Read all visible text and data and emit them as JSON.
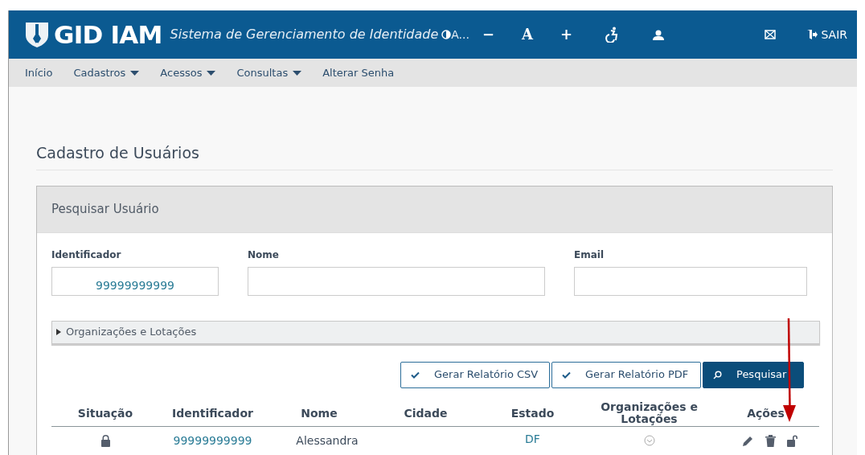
{
  "header": {
    "logo": "GID IAM",
    "subtitle": "Sistema de Gerenciamento de Identidade",
    "contrast_suffix": "A...",
    "font_tools": [
      "−",
      "A",
      "+"
    ],
    "logout": "SAIR"
  },
  "nav": [
    {
      "label": "Início",
      "dropdown": false
    },
    {
      "label": "Cadastros",
      "dropdown": true
    },
    {
      "label": "Acessos",
      "dropdown": true
    },
    {
      "label": "Consultas",
      "dropdown": true
    },
    {
      "label": "Alterar Senha",
      "dropdown": false
    }
  ],
  "page_title": "Cadastro de Usuários",
  "panel": {
    "title": "Pesquisar Usuário",
    "fields": [
      {
        "label": "Identificador",
        "value": "99999999999"
      },
      {
        "label": "Nome"
      },
      {
        "label": "Email"
      }
    ],
    "collapsible": {
      "label": "Organizações e Lotações",
      "expanded": false
    },
    "buttons": [
      {
        "label": "Gerar Relatório CSV",
        "kind": "outline"
      },
      {
        "label": "Gerar Relatório PDF",
        "kind": "outline"
      },
      {
        "label": "Pesquisar",
        "kind": "primary"
      }
    ],
    "table": {
      "columns": [
        "Situação",
        "Identificador",
        "Nome",
        "Cidade",
        "Estado",
        "Organizações e Lotações",
        "Ações"
      ],
      "rows": [
        {
          "locked": true,
          "identificador": "99999999999",
          "nome": "Alessandra",
          "estado": "DF"
        }
      ]
    }
  }
}
